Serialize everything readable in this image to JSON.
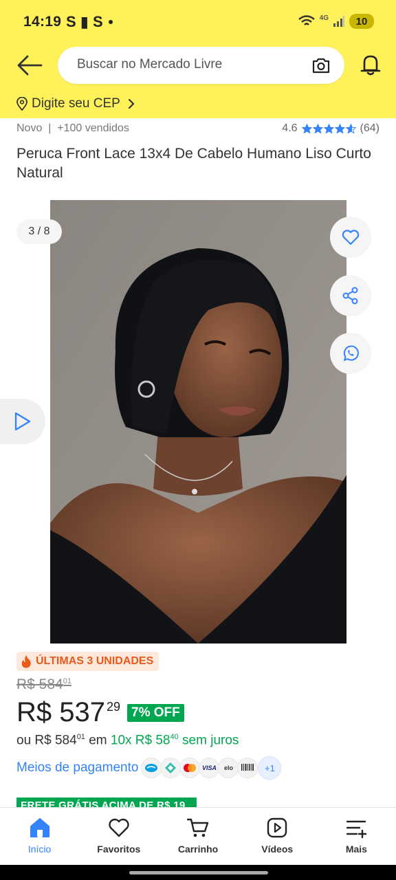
{
  "status_bar": {
    "time": "14:19",
    "notification_icons": "S ▮ S",
    "network": "4G",
    "battery": "10"
  },
  "header": {
    "search_placeholder": "Buscar no Mercado Livre",
    "cep_label": "Digite seu CEP",
    "background_color": "#fff159"
  },
  "product": {
    "condition_sales": "Novo  |  +100 vendidos",
    "rating_value": "4.6",
    "rating_stars": 4.6,
    "rating_count": "(64)",
    "title": "Peruca Front Lace 13x4 De Cabelo Humano Liso Curto Natural",
    "image_counter": "3 / 8"
  },
  "pricing": {
    "stock_badge": "ÚLTIMAS 3 UNIDADES",
    "old_price_main": "R$ 584",
    "old_price_cents": "01",
    "price_main": "R$ 537",
    "price_cents": "29",
    "discount": "7% OFF",
    "installments_prefix": "ou R$ 584",
    "installments_prefix_cents": "01",
    "installments_mid": " em ",
    "installments_green": "10x R$ 58",
    "installments_green_cents": "40",
    "installments_suffix": " sem juros",
    "payment_link": "Meios de pagamento",
    "payment_icons": [
      "mercado-pago",
      "pix",
      "mastercard",
      "visa",
      "elo",
      "boleto"
    ],
    "payment_visa": "VISA",
    "payment_elo": "elo",
    "payment_more": "+1",
    "shipping_banner": "FRETE GRÁTIS ACIMA DE R$ 19"
  },
  "bottom_nav": [
    {
      "label": "Início",
      "icon": "home-icon",
      "active": true
    },
    {
      "label": "Favoritos",
      "icon": "heart-icon",
      "active": false
    },
    {
      "label": "Carrinho",
      "icon": "cart-icon",
      "active": false
    },
    {
      "label": "Vídeos",
      "icon": "video-icon",
      "active": false
    },
    {
      "label": "Mais",
      "icon": "menu-plus-icon",
      "active": false
    }
  ],
  "colors": {
    "accent_blue": "#3483fa",
    "green": "#00a650",
    "orange": "#e85a1a"
  }
}
